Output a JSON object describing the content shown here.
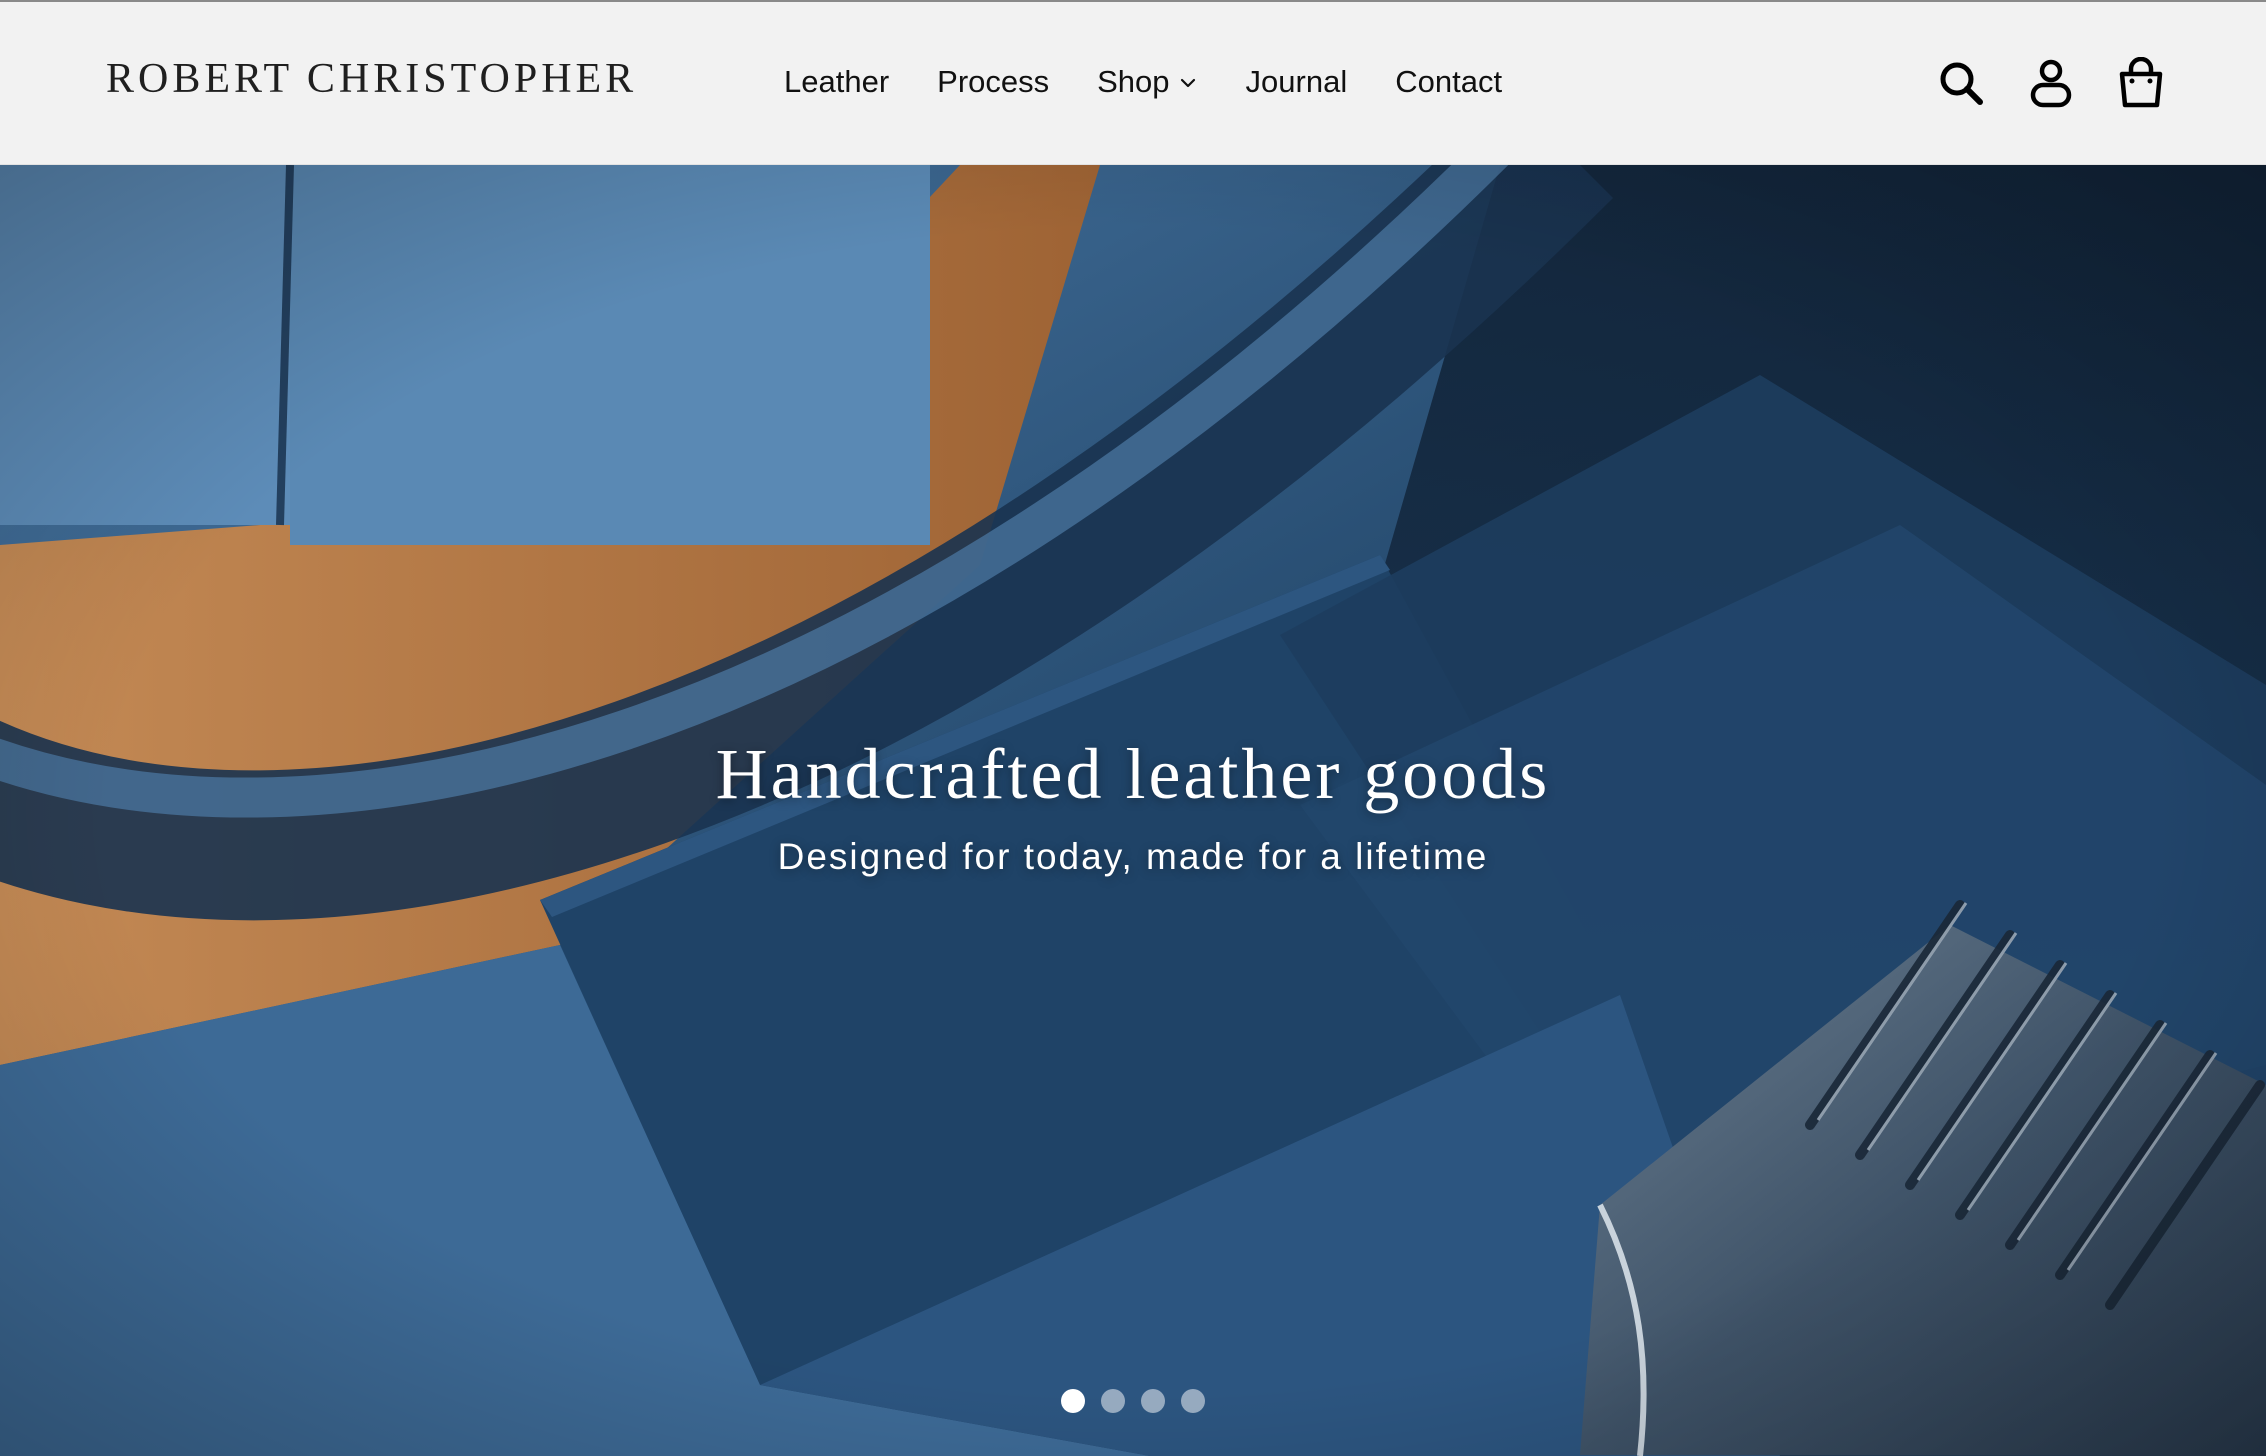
{
  "brand": {
    "name": "ROBERT CHRISTOPHER"
  },
  "nav": {
    "items": [
      {
        "label": "Leather"
      },
      {
        "label": "Process"
      },
      {
        "label": "Shop",
        "has_dropdown": true
      },
      {
        "label": "Journal"
      },
      {
        "label": "Contact"
      }
    ]
  },
  "header_icons": {
    "search": "search-icon",
    "account": "account-icon",
    "cart": "cart-bag-icon"
  },
  "hero": {
    "title": "Handcrafted leather goods",
    "subtitle": "Designed for today, made for a lifetime",
    "slides_total": 4,
    "active_slide": 1
  },
  "colors": {
    "header_bg": "#f2f2f2",
    "text_dark": "#111111",
    "hero_blue": "#23476b",
    "hero_tan": "#b97a45",
    "hero_text": "#ffffff"
  }
}
